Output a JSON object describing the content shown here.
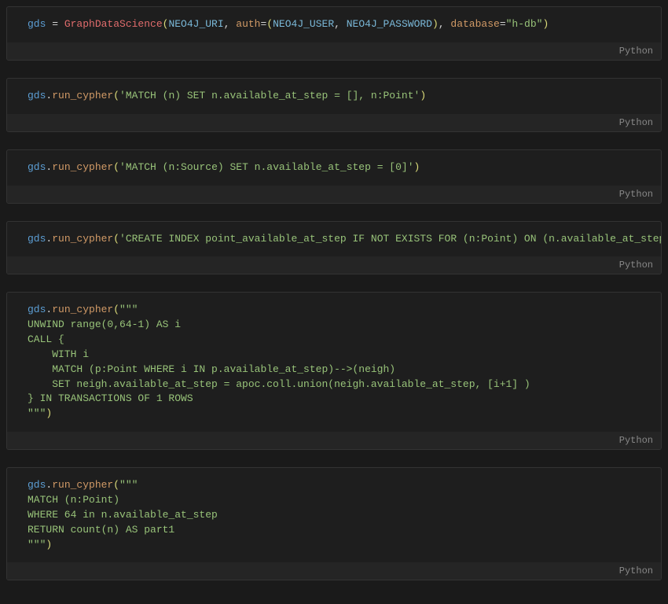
{
  "language_label": "Python",
  "cells": [
    {
      "id": "cell1",
      "tokens": [
        {
          "cls": "tk-var",
          "t": "gds"
        },
        {
          "cls": "tk-op",
          "t": " = "
        },
        {
          "cls": "tk-cls",
          "t": "GraphDataScience"
        },
        {
          "cls": "tk-paren",
          "t": "("
        },
        {
          "cls": "tk-const",
          "t": "NEO4J_URI"
        },
        {
          "cls": "tk-comma",
          "t": ", "
        },
        {
          "cls": "tk-param",
          "t": "auth"
        },
        {
          "cls": "tk-op",
          "t": "="
        },
        {
          "cls": "tk-paren",
          "t": "("
        },
        {
          "cls": "tk-const",
          "t": "NEO4J_USER"
        },
        {
          "cls": "tk-comma",
          "t": ", "
        },
        {
          "cls": "tk-const",
          "t": "NEO4J_PASSWORD"
        },
        {
          "cls": "tk-paren",
          "t": ")"
        },
        {
          "cls": "tk-comma",
          "t": ", "
        },
        {
          "cls": "tk-param",
          "t": "database"
        },
        {
          "cls": "tk-op",
          "t": "="
        },
        {
          "cls": "tk-str",
          "t": "\"h-db\""
        },
        {
          "cls": "tk-paren",
          "t": ")"
        }
      ]
    },
    {
      "id": "cell2",
      "tokens": [
        {
          "cls": "tk-var",
          "t": "gds"
        },
        {
          "cls": "tk-op",
          "t": "."
        },
        {
          "cls": "tk-method",
          "t": "run_cypher"
        },
        {
          "cls": "tk-paren",
          "t": "("
        },
        {
          "cls": "tk-str",
          "t": "'MATCH (n) SET n.available_at_step = [], n:Point'"
        },
        {
          "cls": "tk-paren",
          "t": ")"
        }
      ]
    },
    {
      "id": "cell3",
      "tokens": [
        {
          "cls": "tk-var",
          "t": "gds"
        },
        {
          "cls": "tk-op",
          "t": "."
        },
        {
          "cls": "tk-method",
          "t": "run_cypher"
        },
        {
          "cls": "tk-paren",
          "t": "("
        },
        {
          "cls": "tk-str",
          "t": "'MATCH (n:Source) SET n.available_at_step = [0]'"
        },
        {
          "cls": "tk-paren",
          "t": ")"
        }
      ]
    },
    {
      "id": "cell4",
      "tokens": [
        {
          "cls": "tk-var",
          "t": "gds"
        },
        {
          "cls": "tk-op",
          "t": "."
        },
        {
          "cls": "tk-method",
          "t": "run_cypher"
        },
        {
          "cls": "tk-paren",
          "t": "("
        },
        {
          "cls": "tk-str",
          "t": "'CREATE INDEX point_available_at_step IF NOT EXISTS FOR (n:Point) ON (n.available_at_step)'"
        },
        {
          "cls": "tk-paren",
          "t": ")"
        }
      ]
    },
    {
      "id": "cell5",
      "tokens": [
        {
          "cls": "tk-var",
          "t": "gds"
        },
        {
          "cls": "tk-op",
          "t": "."
        },
        {
          "cls": "tk-method",
          "t": "run_cypher"
        },
        {
          "cls": "tk-paren",
          "t": "("
        },
        {
          "cls": "tk-str",
          "t": "\"\"\"\nUNWIND range(0,64-1) AS i\nCALL {\n    WITH i\n    MATCH (p:Point WHERE i IN p.available_at_step)-->(neigh)\n    SET neigh.available_at_step = apoc.coll.union(neigh.available_at_step, [i+1] )\n} IN TRANSACTIONS OF 1 ROWS\n\"\"\""
        },
        {
          "cls": "tk-paren",
          "t": ")"
        }
      ]
    },
    {
      "id": "cell6",
      "tokens": [
        {
          "cls": "tk-var",
          "t": "gds"
        },
        {
          "cls": "tk-op",
          "t": "."
        },
        {
          "cls": "tk-method",
          "t": "run_cypher"
        },
        {
          "cls": "tk-paren",
          "t": "("
        },
        {
          "cls": "tk-str",
          "t": "\"\"\"\nMATCH (n:Point)\nWHERE 64 in n.available_at_step\nRETURN count(n) AS part1\n\"\"\""
        },
        {
          "cls": "tk-paren",
          "t": ")"
        }
      ]
    }
  ]
}
